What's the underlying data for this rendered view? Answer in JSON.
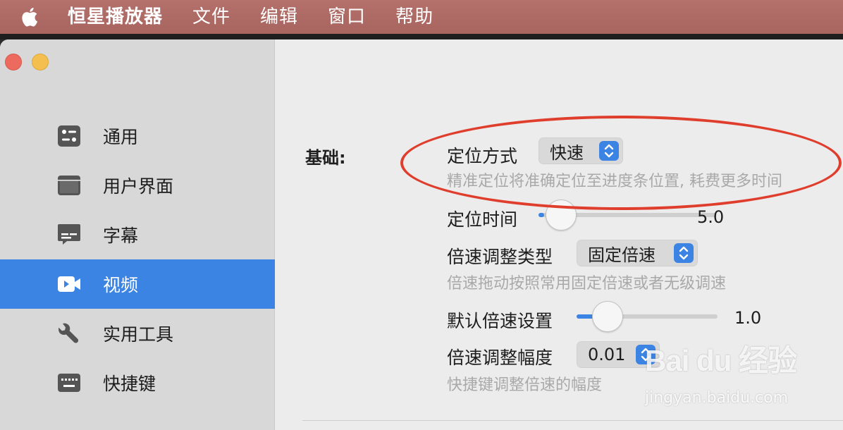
{
  "menubar": {
    "apple_icon": "apple-icon",
    "app_name": "恒星播放器",
    "items": [
      "文件",
      "编辑",
      "窗口",
      "帮助"
    ]
  },
  "sidebar": {
    "items": [
      {
        "label": "通用",
        "icon": "general-settings-icon"
      },
      {
        "label": "用户界面",
        "icon": "window-icon"
      },
      {
        "label": "字幕",
        "icon": "subtitle-icon"
      },
      {
        "label": "视频",
        "icon": "video-camera-icon",
        "selected": true
      },
      {
        "label": "实用工具",
        "icon": "wrench-icon"
      },
      {
        "label": "快捷键",
        "icon": "keyboard-icon"
      }
    ]
  },
  "content": {
    "section_label": "基础:",
    "seek_mode": {
      "label": "定位方式",
      "value": "快速",
      "hint": "精准定位将准确定位至进度条位置, 耗费更多时间"
    },
    "seek_time": {
      "label": "定位时间",
      "value": "5.0",
      "level": 0.0
    },
    "speed_type": {
      "label": "倍速调整类型",
      "value": "固定倍速",
      "hint": "倍速拖动按照常用固定倍速或者无级调速"
    },
    "default_speed": {
      "label": "默认倍速设置",
      "value": "1.0",
      "level": 0.1
    },
    "speed_step": {
      "label": "倍速调整幅度",
      "value": "0.01",
      "hint": "快捷键调整倍速的幅度"
    }
  },
  "colors": {
    "accent": "#3b84e3",
    "menubar": "#ad6a64",
    "annotation": "#e03e2d"
  },
  "watermark": {
    "logo": "Bai du 经验",
    "url": "jingyan.baidu.com"
  }
}
